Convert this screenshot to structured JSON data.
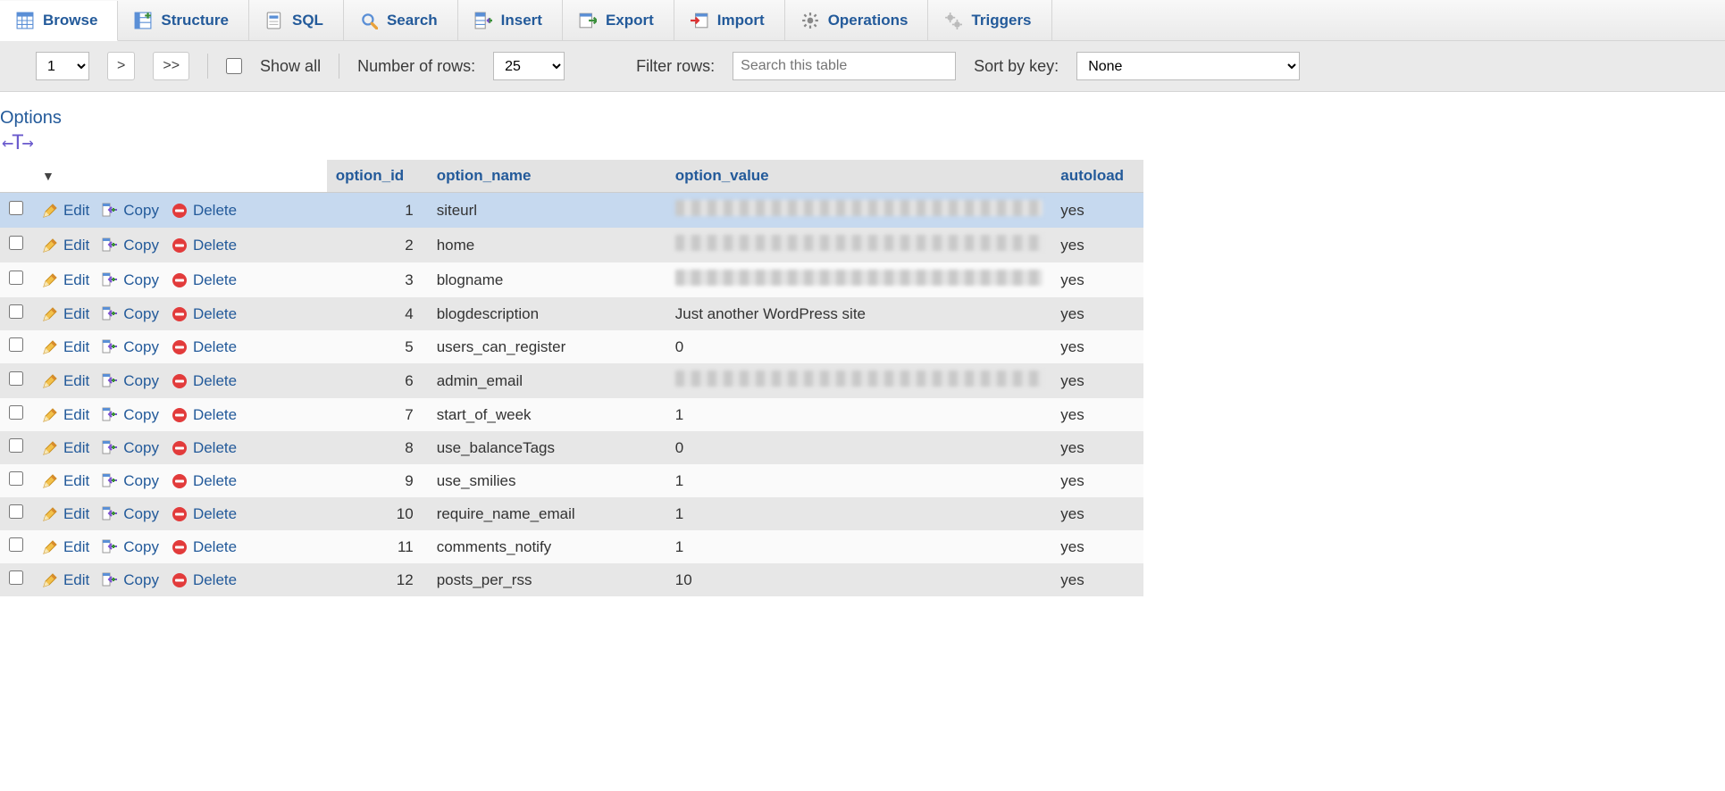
{
  "tabs": [
    {
      "id": "browse",
      "label": "Browse",
      "active": true
    },
    {
      "id": "structure",
      "label": "Structure",
      "active": false
    },
    {
      "id": "sql",
      "label": "SQL",
      "active": false
    },
    {
      "id": "search",
      "label": "Search",
      "active": false
    },
    {
      "id": "insert",
      "label": "Insert",
      "active": false
    },
    {
      "id": "export",
      "label": "Export",
      "active": false
    },
    {
      "id": "import",
      "label": "Import",
      "active": false
    },
    {
      "id": "operations",
      "label": "Operations",
      "active": false
    },
    {
      "id": "triggers",
      "label": "Triggers",
      "active": false
    }
  ],
  "toolbar": {
    "page_current": "1",
    "page_next": ">",
    "page_last": ">>",
    "show_all_label": "Show all",
    "num_rows_label": "Number of rows:",
    "num_rows_value": "25",
    "filter_label": "Filter rows:",
    "filter_placeholder": "Search this table",
    "sort_label": "Sort by key:",
    "sort_value": "None"
  },
  "options_heading": "Options",
  "columns": {
    "option_id": "option_id",
    "option_name": "option_name",
    "option_value": "option_value",
    "autoload": "autoload"
  },
  "row_action_labels": {
    "edit": "Edit",
    "copy": "Copy",
    "delete": "Delete"
  },
  "rows": [
    {
      "option_id": 1,
      "option_name": "siteurl",
      "option_value": null,
      "autoload": "yes",
      "selected": true
    },
    {
      "option_id": 2,
      "option_name": "home",
      "option_value": null,
      "autoload": "yes",
      "selected": false
    },
    {
      "option_id": 3,
      "option_name": "blogname",
      "option_value": null,
      "autoload": "yes",
      "selected": false
    },
    {
      "option_id": 4,
      "option_name": "blogdescription",
      "option_value": "Just another WordPress site",
      "autoload": "yes",
      "selected": false
    },
    {
      "option_id": 5,
      "option_name": "users_can_register",
      "option_value": "0",
      "autoload": "yes",
      "selected": false
    },
    {
      "option_id": 6,
      "option_name": "admin_email",
      "option_value": null,
      "autoload": "yes",
      "selected": false
    },
    {
      "option_id": 7,
      "option_name": "start_of_week",
      "option_value": "1",
      "autoload": "yes",
      "selected": false
    },
    {
      "option_id": 8,
      "option_name": "use_balanceTags",
      "option_value": "0",
      "autoload": "yes",
      "selected": false
    },
    {
      "option_id": 9,
      "option_name": "use_smilies",
      "option_value": "1",
      "autoload": "yes",
      "selected": false
    },
    {
      "option_id": 10,
      "option_name": "require_name_email",
      "option_value": "1",
      "autoload": "yes",
      "selected": false
    },
    {
      "option_id": 11,
      "option_name": "comments_notify",
      "option_value": "1",
      "autoload": "yes",
      "selected": false
    },
    {
      "option_id": 12,
      "option_name": "posts_per_rss",
      "option_value": "10",
      "autoload": "yes",
      "selected": false
    }
  ]
}
